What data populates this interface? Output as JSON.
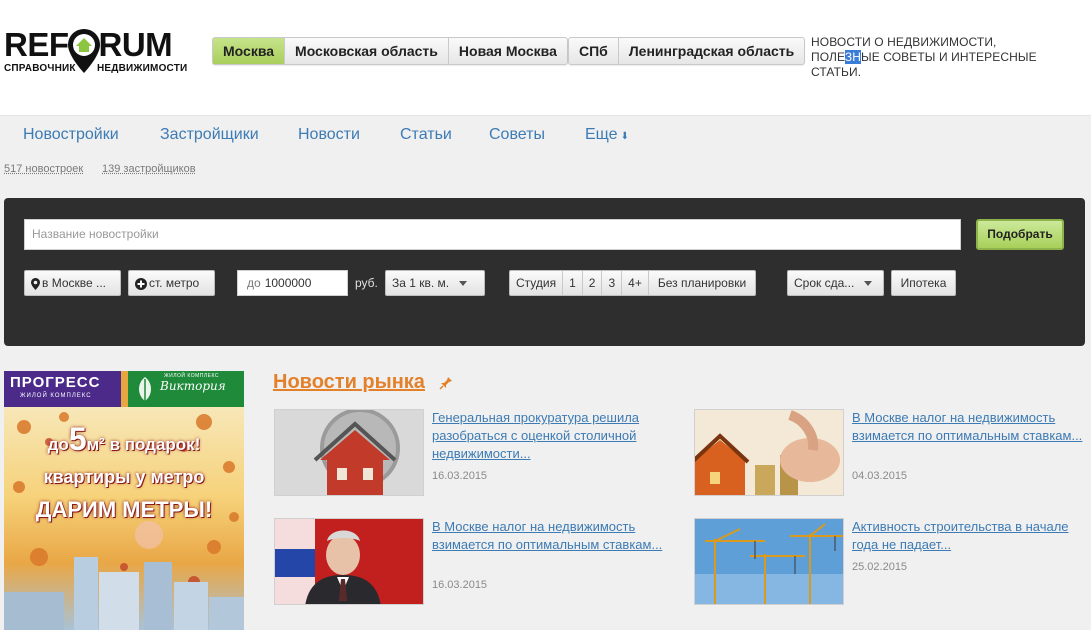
{
  "logo": {
    "word_left": "REF",
    "word_right": "RUM",
    "sub_left": "СПРАВОЧНИК",
    "sub_right": "НЕДВИЖИМОСТИ"
  },
  "regions": {
    "group1": [
      "Москва",
      "Московская область",
      "Новая Москва"
    ],
    "group2": [
      "СПб",
      "Ленинградская область"
    ],
    "active": "Москва"
  },
  "tagline": {
    "line1": "НОВОСТИ О НЕДВИЖИМОСТИ,",
    "line2_a": "ПОЛЕ",
    "line2_sel": "ЗН",
    "line2_b": "ЫЕ СОВЕТЫ И ИНТЕРЕСНЫЕ СТАТЬИ."
  },
  "nav": {
    "items": [
      "Новостройки",
      "Застройщики",
      "Новости",
      "Статьи",
      "Советы",
      "Еще"
    ],
    "more_arrow": "⬇"
  },
  "subnav": {
    "newbuilds": "517 новостроек",
    "developers": "139 застройщиков"
  },
  "search": {
    "name_placeholder": "Название новостройки",
    "pick_label": "Подобрать",
    "location_label": "в Москве ...",
    "metro_label": "ст. метро",
    "price_prefix": "до",
    "price_value": "1000000",
    "currency": "руб.",
    "unit_select": "За 1 кв. м.",
    "rooms": [
      "Студия",
      "1",
      "2",
      "3",
      "4+",
      "Без планировки"
    ],
    "term_select": "Срок сда...",
    "mortgage_label": "Ипотека"
  },
  "banner": {
    "brand1": "ПРОГРЕСС",
    "brand1_sub": "ЖИЛОЙ КОМПЛЕКС",
    "brand2": "Виктория",
    "brand2_sub": "ЖИЛОЙ КОМПЛЕКС",
    "line1_pre": "до",
    "line1_big": "5",
    "line1_post": "м² в подарок!",
    "line2": "квартиры у метро",
    "line3": "ДАРИМ МЕТРЫ!"
  },
  "news": {
    "title": "Новости рынка",
    "items": [
      {
        "text": "Генеральная прокуратура решила разобраться с оценкой столичной недвижимости...",
        "date": "16.03.2015"
      },
      {
        "text": "В Москве налог на недвижимость взимается по оптимальным ставкам...",
        "date": "04.03.2015"
      },
      {
        "text": "В Москве налог на недвижимость взимается по оптимальным ставкам...",
        "date": "16.03.2015"
      },
      {
        "text": "Активность строительства в начале года не падает...",
        "date": "25.02.2015"
      }
    ]
  },
  "colors": {
    "accent_green": "#a9cf5c",
    "link_blue": "#3d7bb4",
    "news_orange": "#e3802a",
    "panel_dark": "#2e2e2e"
  }
}
